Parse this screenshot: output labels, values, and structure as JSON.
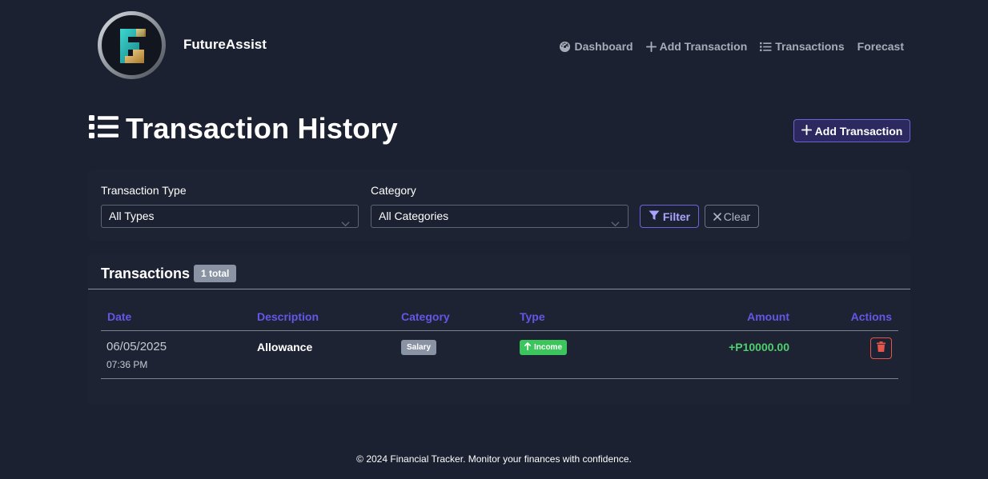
{
  "app": {
    "brand_name": "FutureAssist",
    "logo_icon": "futureassist-logo",
    "accent_color": "#6c63d9"
  },
  "nav": {
    "items": [
      {
        "label": "Dashboard",
        "icon": "dashboard-gauge-icon"
      },
      {
        "label": "Add Transaction",
        "icon": "plus-icon"
      },
      {
        "label": "Transactions",
        "icon": "list-icon"
      },
      {
        "label": "Forecast",
        "icon": ""
      }
    ]
  },
  "page": {
    "title": "Transaction History",
    "title_icon": "list-icon",
    "add_button_label": "Add Transaction"
  },
  "filters": {
    "type_label": "Transaction Type",
    "type_selected": "All Types",
    "category_label": "Category",
    "category_selected": "All Categories",
    "filter_button": "Filter",
    "clear_button": "Clear"
  },
  "transactions": {
    "title": "Transactions",
    "total_badge": "1 total",
    "columns": {
      "date": "Date",
      "description": "Description",
      "category": "Category",
      "type": "Type",
      "amount": "Amount",
      "actions": "Actions"
    },
    "rows": [
      {
        "date": "06/05/2025",
        "time": "07:36 PM",
        "description": "Allowance",
        "category": "Salary",
        "type": "Income",
        "amount": "+P10000.00",
        "amount_color": "#4fcf6e"
      }
    ]
  },
  "footer": {
    "text": "© 2024 Financial Tracker. Monitor your finances with confidence."
  }
}
